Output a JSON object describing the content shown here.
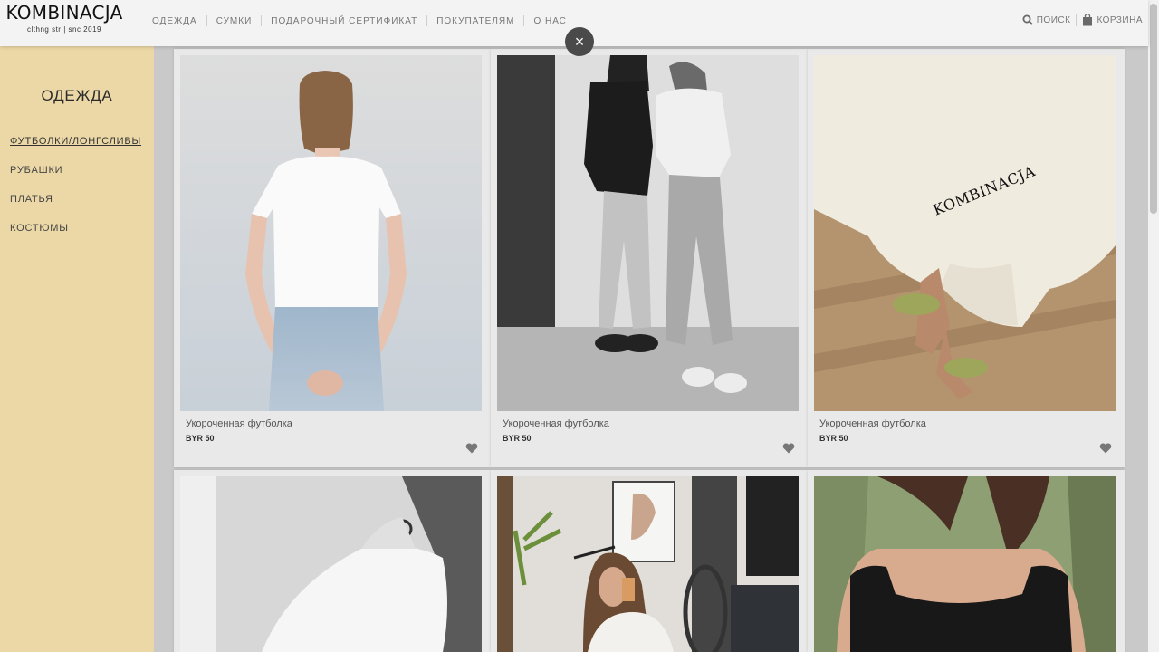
{
  "brand": {
    "name": "KOMBINACJA",
    "tagline": "clthng str | snc 2019"
  },
  "nav": {
    "items": [
      "ОДЕЖДА",
      "СУМКИ",
      "ПОДАРОЧНЫЙ СЕРТИФИКАТ",
      "ПОКУПАТЕЛЯМ",
      "О НАС"
    ],
    "search_label": "ПОИСК",
    "cart_label": "КОРЗИНА"
  },
  "close_label": "×",
  "sidebar": {
    "title": "ОДЕЖДА",
    "categories": [
      "ФУТБОЛКИ/ЛОНГСЛИВЫ",
      "РУБАШКИ",
      "ПЛАТЬЯ",
      "КОСТЮМЫ"
    ],
    "active_index": 0
  },
  "products": [
    {
      "title": "Укороченная футболка",
      "price": "BYR 50"
    },
    {
      "title": "Укороченная футболка",
      "price": "BYR 50"
    },
    {
      "title": "Укороченная футболка",
      "price": "BYR 50"
    }
  ],
  "print_text": "KOMBINACJA",
  "colors": {
    "sidebar_bg": "#ecd8a6",
    "header_bg": "#f3f3f3",
    "close_bg": "#4a4a4a",
    "heart": "#777777"
  },
  "icons": {
    "search": "search-icon",
    "cart": "shopping-bag-icon",
    "favorite": "heart-icon",
    "close": "close-icon"
  }
}
